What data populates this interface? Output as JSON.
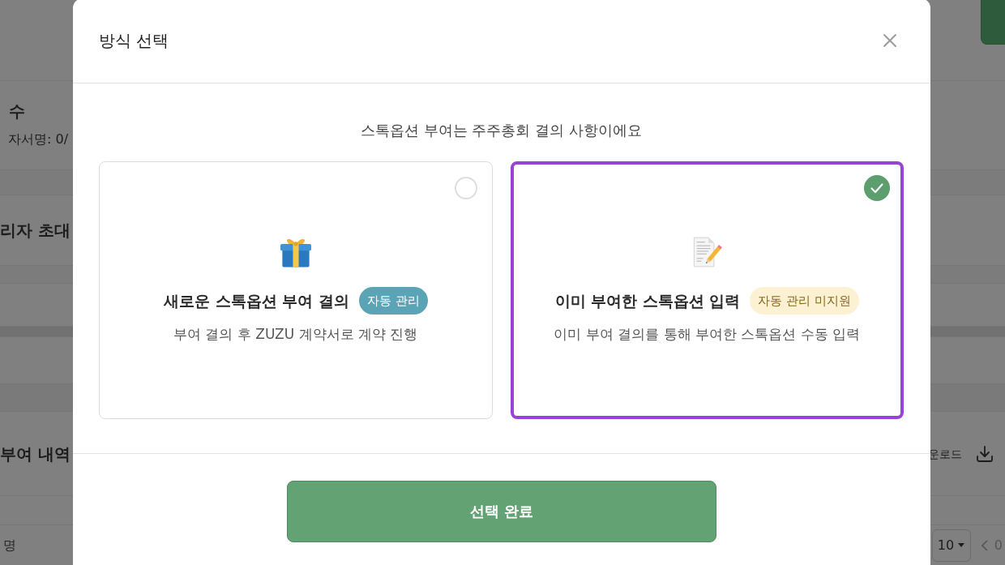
{
  "background_page": {
    "signature_section": {
      "title": "수",
      "subtitle": "자서명: 0/"
    },
    "invite_section": {
      "title": "리자 초대"
    },
    "history_section": {
      "title": "부여 내역",
      "download_label": "운로드"
    },
    "table_footer": {
      "cell": "명",
      "page_size": "10",
      "page_info": "0"
    }
  },
  "dialog": {
    "title": "방식 선택",
    "subtitle": "스톡옵션 부여는 주주총회 결의 사항이에요",
    "options": [
      {
        "kind": "new",
        "title": "새로운 스톡옵션 부여 결의",
        "badge": "자동 관리",
        "description": "부여 결의 후 ZUZU 계약서로 계약 진행",
        "selected": false
      },
      {
        "kind": "existing",
        "title": "이미 부여한 스톡옵션 입력",
        "badge": "자동 관리 미지원",
        "description": "이미 부여 결의를 통해 부여한 스톡옵션 수동 입력",
        "selected": true
      }
    ],
    "confirm_button": "선택 완료"
  }
}
